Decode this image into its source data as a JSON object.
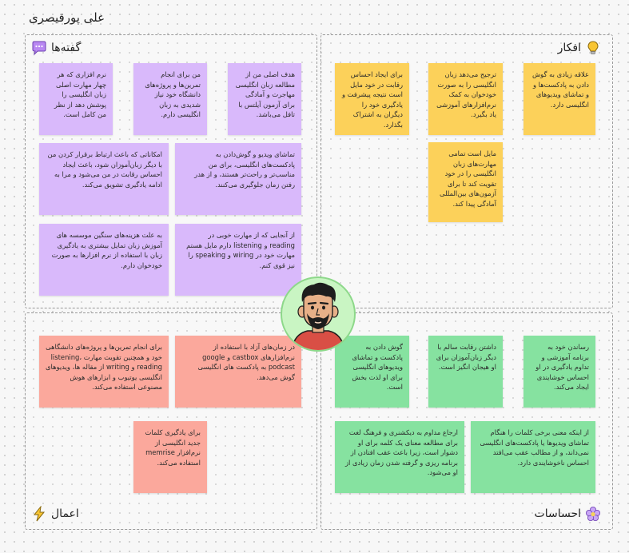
{
  "board": {
    "title": "علی پورقیصری"
  },
  "quadrants": {
    "thoughts": {
      "label": "افکار",
      "icon": "lightbulb-icon"
    },
    "sayings": {
      "label": "گفته‌ها",
      "icon": "speech-bubble-icon"
    },
    "actions": {
      "label": "اعمال",
      "icon": "lightning-icon"
    },
    "feelings": {
      "label": "احساسات",
      "icon": "flower-icon"
    }
  },
  "notes": {
    "thoughts": [
      "علاقه زیادی به گوش دادن به پادکست‌ها و و تماشای ویدیوهای انگلیسی دارد.",
      "ترجیح می‌دهد زبان انگلیسی را به صورت خودخوان به کمک نرم‌افزارهای آموزشی یاد بگیرد.",
      "برای ایجاد احساس رقابت در خود مایل است نتیجه پیشرفت و یادگیری خود را دیگران به اشتراک بگذارد.",
      "مایل است تمامی مهارت‌های زبان انگلیسی را در خود تقویت کند تا برای آزمون‌های بین‌المللی آمادگی پیدا کند."
    ],
    "sayings": [
      "هدف اصلی من از مطالعه زبان انگلیسی مهاجرت و آمادگی برای آزمون آیلتس با تافل می‌باشد.",
      "من برای انجام تمرین‌ها و پروژه‌های دانشگاه خود نیاز شدیدی به زبان انگلیسی دارم.",
      "نرم افزاری که هر چهار مهارت اصلی زبان انگلیسی را پوشش دهد از نظر من کامل است.",
      "تماشای ویدیو و گوش‌دادن به پادکست‌های انگلیسی، برای من مناسب‌تر و راحت‌تر هستند، و از هدر رفتن زمان جلوگیری می‌کنند.",
      "امکاناتی که باعث ارتباط برقرار کردن من با دیگر زبان‌آموزان شود، باعث ایجاد احساس رقابت در من می‌شود و مرا به ادامه یادگیری تشویق می‌کند.",
      "از آنجایی که از مهارت خوبی در reading و listening دارم مایل هستم مهارت خود در wiring و speaking را نیز قوی کنم.",
      "به علت هزینه‌های سنگین موسسه های آموزش زبان تمایل بیشتری به یادگیری زبان با استفاده از نرم افزارها به صورت خودخوان دارم."
    ],
    "actions": [
      "در زمان‌های آزاد با استفاده از نرم‌افزارهای castbox و google podcast به پادکست های انگلیسی گوش می‌دهد.",
      "برای انجام تمرین‌ها و پروژه‌های دانشگاهی خود و همچنین تقویت مهارت listening، reading و writing از مقاله ها، ویدیوهای انگلیسی یوتیوب و ابزارهای هوش مصنوعی استفاده می‌کند.",
      "برای یادگیری کلمات جدید انگلیسی از نرم‌افزار memrise استفاده می‌کند."
    ],
    "feelings": [
      "رساندن خود به برنامه آموزشی و تداوم یادگیری در او احساس خوشایندی ایجاد می‌کند.",
      "داشتن رقابت سالم با دیگر زبان‌آموزان برای او هیجان انگیز است.",
      "گوش دادن به پادکست و تماشای ویدیوهای انگلیسی برای او لذت بخش است.",
      "از اینکه معنی برخی کلمات را هنگام تماشای ویدیوها یا پادکست‌های انگلیسی نمی‌داند، و از مطالب عقب می‌افتد احساس ناخوشایندی دارد.",
      "ارجاع مداوم به دیکشنری و فرهنگ لغت برای مطالعه معنای یک کلمه برای او دشوار است، زیرا باعث عقب افتادن از برنامه ریزی و گرفته شدن زمان زیادی از او می‌شود."
    ]
  },
  "colors": {
    "yellow": "#fcd15a",
    "purple": "#d9b9fb",
    "green": "#86e2a0",
    "salmon": "#fba89c"
  },
  "avatar": {
    "icon": "person-avatar-icon"
  }
}
